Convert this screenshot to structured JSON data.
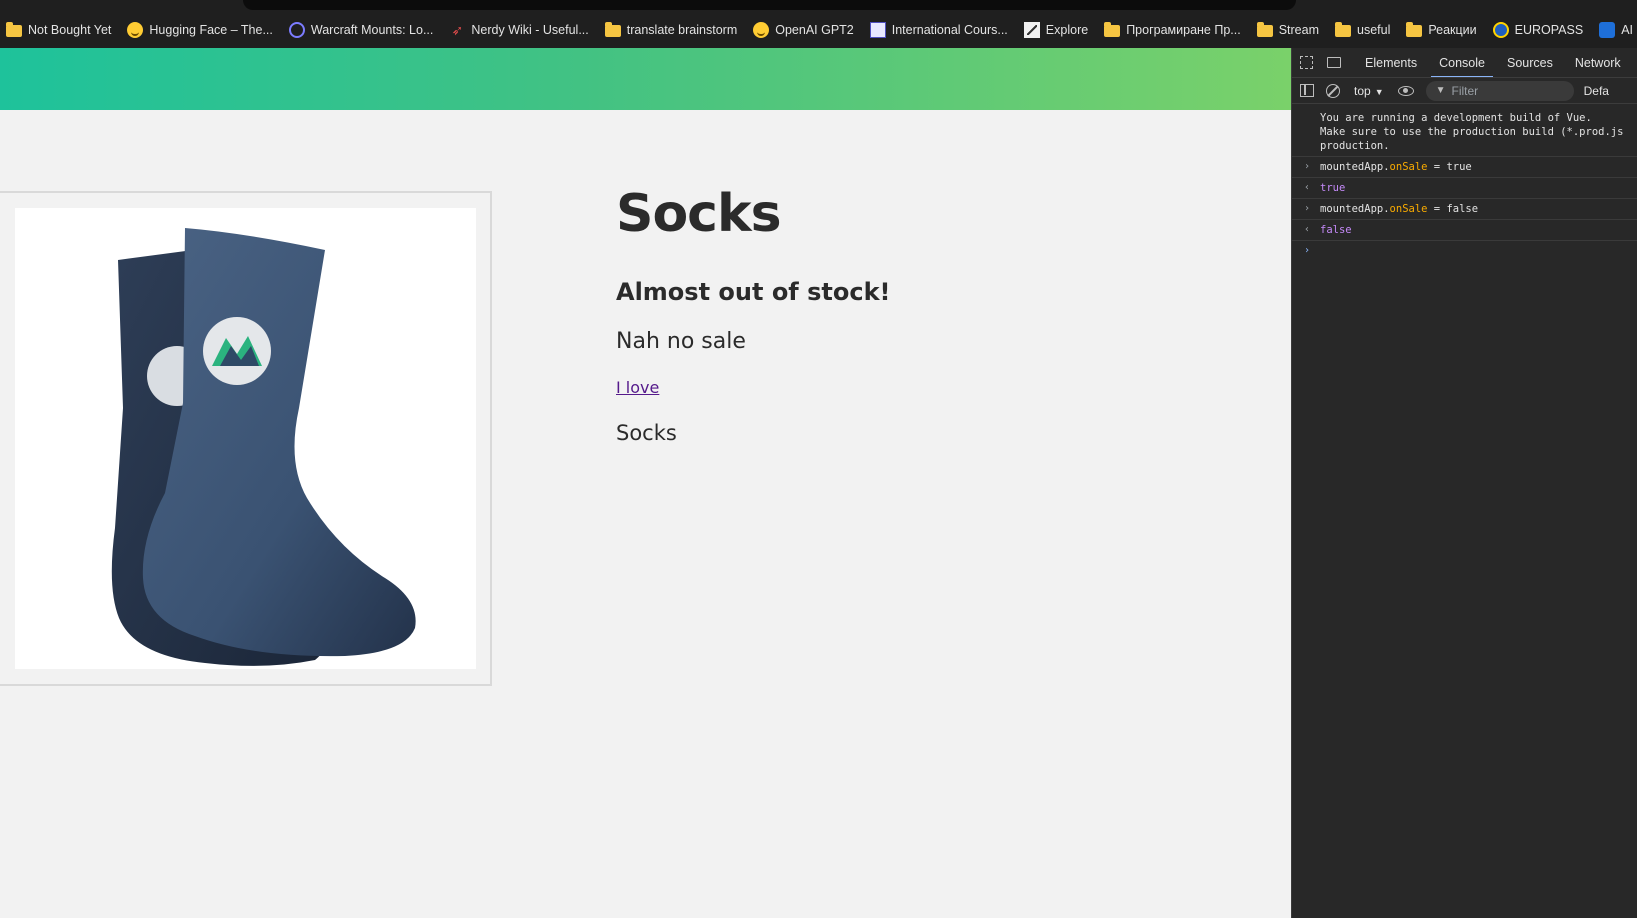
{
  "bookmarks": [
    {
      "label": "Not Bought Yet",
      "icon": "folder-icon"
    },
    {
      "label": "Hugging Face – The...",
      "icon": "hugging-face-icon"
    },
    {
      "label": "Warcraft Mounts: Lo...",
      "icon": "warcraft-icon"
    },
    {
      "label": "Nerdy Wiki - Useful...",
      "icon": "rocket-icon"
    },
    {
      "label": "translate brainstorm",
      "icon": "folder-icon"
    },
    {
      "label": "OpenAI GPT2",
      "icon": "hugging-face-icon"
    },
    {
      "label": "International Cours...",
      "icon": "dictionary-icon"
    },
    {
      "label": "Explore",
      "icon": "explore-icon"
    },
    {
      "label": "Програмиране Пр...",
      "icon": "folder-icon"
    },
    {
      "label": "Stream",
      "icon": "folder-icon"
    },
    {
      "label": "useful",
      "icon": "folder-icon"
    },
    {
      "label": "Реакции",
      "icon": "folder-icon"
    },
    {
      "label": "EUROPASS",
      "icon": "europass-icon"
    },
    {
      "label": "AI Photo Ed",
      "icon": "photo-editor-icon"
    }
  ],
  "header": {
    "gradient_start": "#1ec29b",
    "gradient_end": "#7ad16a"
  },
  "product": {
    "title": "Socks",
    "stock_status": "Almost out of stock!",
    "sale_status": "Nah no sale",
    "link_text": "I love",
    "description": "Socks",
    "image": "sock-product-image"
  },
  "devtools": {
    "tabs": [
      "Elements",
      "Console",
      "Sources",
      "Network"
    ],
    "active_tab": "Console",
    "context": "top",
    "filter_placeholder": "Filter",
    "levels": "Defa",
    "console": {
      "warning_line1": "You are running a development build of Vue.",
      "warning_line2": "Make sure to use the production build (*.prod.js",
      "warning_line3": "production.",
      "cmd1_obj": "mountedApp.",
      "cmd1_prop": "onSale",
      "cmd1_rest": " = true",
      "result1": "true",
      "cmd2_obj": "mountedApp.",
      "cmd2_prop": "onSale",
      "cmd2_rest": " = false",
      "result2": "false"
    }
  }
}
